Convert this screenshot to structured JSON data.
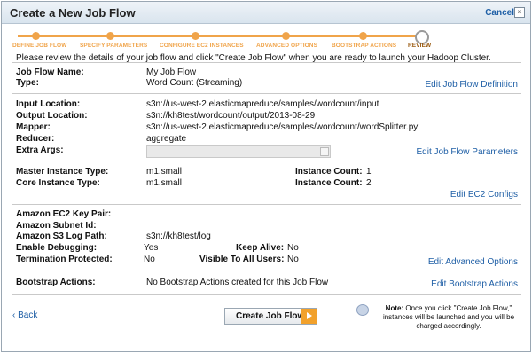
{
  "dialog": {
    "title": "Create a New Job Flow",
    "cancel_label": "Cancel",
    "close_glyph": "×"
  },
  "steps": [
    {
      "label": "DEFINE JOB FLOW"
    },
    {
      "label": "SPECIFY PARAMETERS"
    },
    {
      "label": "CONFIGURE EC2 INSTANCES"
    },
    {
      "label": "ADVANCED OPTIONS"
    },
    {
      "label": "BOOTSTRAP ACTIONS"
    },
    {
      "label": "REVIEW"
    }
  ],
  "intro": "Please review the details of your job flow and click \"Create Job Flow\" when you are ready to launch your Hadoop Cluster.",
  "definition": {
    "name_label": "Job Flow Name:",
    "name_value": "My Job Flow",
    "type_label": "Type:",
    "type_value": "Word Count (Streaming)",
    "edit_label": "Edit Job Flow Definition"
  },
  "parameters": {
    "input_label": "Input Location:",
    "input_value": "s3n://us-west-2.elasticmapreduce/samples/wordcount/input",
    "output_label": "Output Location:",
    "output_value": "s3n://kh8test/wordcount/output/2013-08-29",
    "mapper_label": "Mapper:",
    "mapper_value": "s3n://us-west-2.elasticmapreduce/samples/wordcount/wordSplitter.py",
    "reducer_label": "Reducer:",
    "reducer_value": "aggregate",
    "extra_label": "Extra Args:",
    "extra_value": "",
    "edit_label": "Edit Job Flow Parameters"
  },
  "ec2": {
    "master_type_label": "Master Instance Type:",
    "master_type_value": "m1.small",
    "master_count_label": "Instance Count:",
    "master_count_value": "1",
    "core_type_label": "Core Instance Type:",
    "core_type_value": "m1.small",
    "core_count_label": "Instance Count:",
    "core_count_value": "2",
    "edit_label": "Edit EC2 Configs"
  },
  "advanced": {
    "keypair_label": "Amazon EC2 Key Pair:",
    "keypair_value": "",
    "subnet_label": "Amazon Subnet Id:",
    "subnet_value": "",
    "s3log_label": "Amazon S3 Log Path:",
    "s3log_value": "s3n://kh8test/log",
    "debug_label": "Enable Debugging:",
    "debug_value": "Yes",
    "keepalive_label": "Keep Alive:",
    "keepalive_value": "No",
    "termination_label": "Termination Protected:",
    "termination_value": "No",
    "visible_label": "Visible To All Users:",
    "visible_value": "No",
    "edit_label": "Edit Advanced Options"
  },
  "bootstrap": {
    "label": "Bootstrap Actions:",
    "value": "No Bootstrap Actions created for this Job Flow",
    "edit_label": "Edit Bootstrap Actions"
  },
  "footer": {
    "back_label": "‹ Back",
    "create_label": "Create Job Flow",
    "note_bold": "Note:",
    "note_text": "Once you click \"Create Job Flow,\" instances will be launched and you will be charged accordingly."
  },
  "colors": {
    "accent": "#f0a44a",
    "link": "#1f5fa6"
  }
}
